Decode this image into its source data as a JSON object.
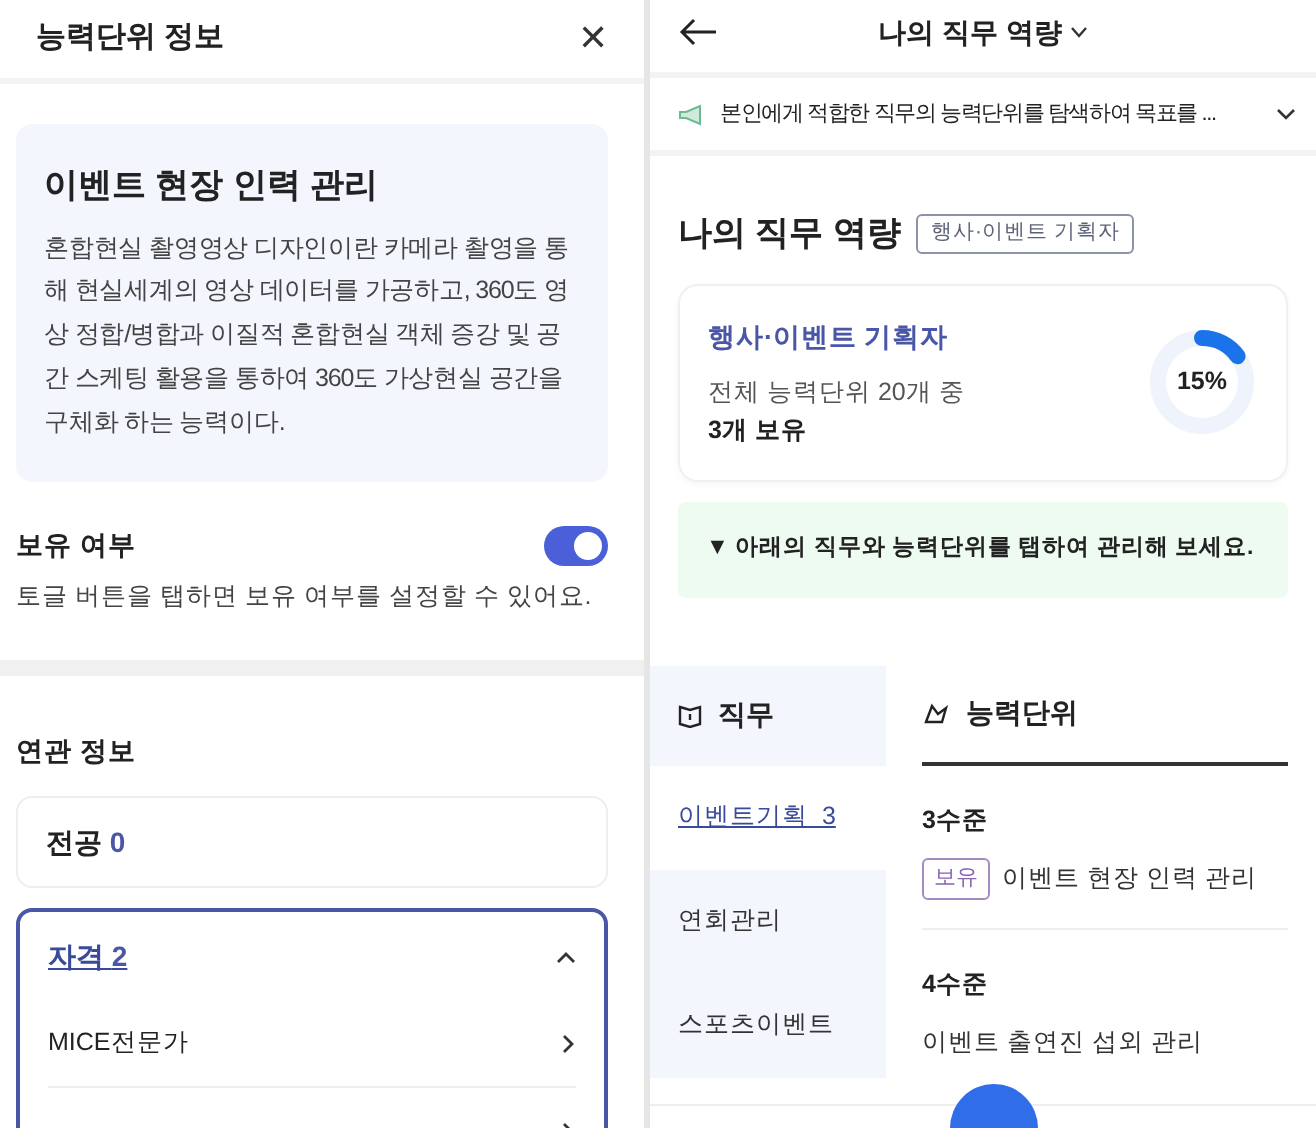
{
  "left_panel": {
    "title": "능력단위 정보",
    "close": "✕",
    "unit": {
      "title": "이벤트 현장 인력 관리",
      "description": "혼합현실 촬영영상 디자인이란 카메라 촬영을 통해 현실세계의 영상 데이터를 가공하고, 360도 영상 정합/병합과 이질적 혼합현실 객체 증강 및 공간 스케팅 활용을 통하여 360도 가상현실 공간을 구체화 하는 능력이다."
    },
    "ownership": {
      "label": "보유 여부",
      "on": true,
      "hint": "토글 버튼을 탭하면 보유 여부를 설정할 수 있어요."
    },
    "related": {
      "title": "연관 정보",
      "sections": [
        {
          "label": "전공",
          "count": "0",
          "expanded": false
        },
        {
          "label": "자격",
          "count": "2",
          "expanded": true,
          "items": [
            {
              "kind": "labeled",
              "label": "MICE전문가"
            },
            {
              "kind": "chevron-only"
            }
          ]
        }
      ]
    }
  },
  "right_panel": {
    "title": "나의 직무 역량",
    "notice": "본인에게 적합한 직무의 능력단위를 탐색하여 목표를 ...",
    "section_title": "나의 직무 역량",
    "job_badge": "행사·이벤트 기획자",
    "summary": {
      "job": "행사·이벤트 기획자",
      "total": "전체 능력단위 20개 중",
      "owned": "3개 보유",
      "level": 0.15,
      "reading": "15%"
    },
    "hint": "▼ 아래의 직무와 능력단위를 탭하여 관리해 보세요.",
    "jobs_header": "직무",
    "units_header": "능력단위",
    "jobs": [
      {
        "label": "이벤트기획",
        "count": "3",
        "selected": true
      },
      {
        "label": "연회관리",
        "selected": false
      },
      {
        "label": "스포츠이벤트",
        "selected": false
      }
    ],
    "levels": [
      {
        "title": "3수준",
        "units": [
          {
            "name": "이벤트 현장 인력 관리",
            "owned": true,
            "badge": "보유"
          }
        ]
      },
      {
        "title": "4수준",
        "units": [
          {
            "name": "이벤트 출연진 섭외 관리",
            "owned": false
          }
        ]
      }
    ]
  }
}
